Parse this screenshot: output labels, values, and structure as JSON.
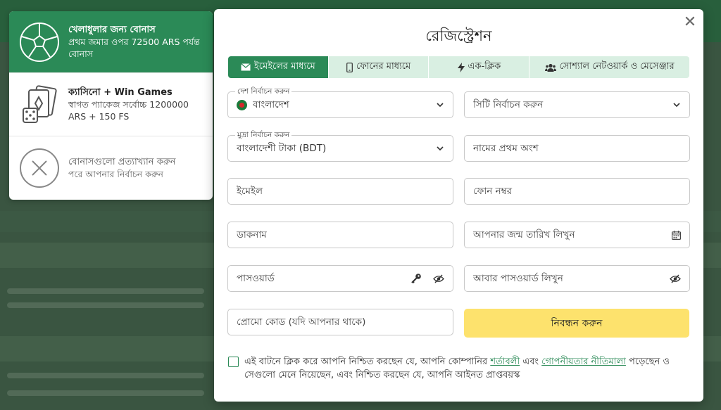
{
  "bonus": {
    "sports": {
      "title": "খেলাধুলার জন্য বোনাস",
      "desc": "প্রথম জমার ওপর 72500 ARS পর্যন্ত বোনাস"
    },
    "casino": {
      "title": "ক্যাসিনো + Win Games",
      "desc": "স্বাগত প্যাকেজ সর্বোচ্চ 1200000 ARS + 150 FS"
    },
    "decline": {
      "title": "বোনাসগুলো প্রত্যাখ্যান করুন",
      "desc": "পরে আপনার নির্বাচন করুন"
    }
  },
  "modal": {
    "title": "রেজিস্ট্রেশন",
    "close": "✕",
    "tabs": [
      {
        "label": "ইমেইলের মাধ্যমে",
        "icon": "envelope-icon"
      },
      {
        "label": "ফোনের মাধ্যমে",
        "icon": "phone-icon"
      },
      {
        "label": "এক-ক্লিক",
        "icon": "lightning-icon"
      },
      {
        "label": "সোশ্যাল নেটওয়ার্ক ও মেসেঞ্জার",
        "icon": "users-icon"
      }
    ],
    "country": {
      "label": "দেশ নির্বাচন করুন",
      "value": "বাংলাদেশ"
    },
    "city": {
      "placeholder": "সিটি নির্বাচন করুন"
    },
    "currency": {
      "label": "মুদ্রা নির্বাচন করুন",
      "value": "বাংলাদেশী টাকা (BDT)"
    },
    "first_name": {
      "placeholder": "নামের প্রথম অংশ"
    },
    "email": {
      "placeholder": "ইমেইল"
    },
    "phone": {
      "placeholder": "ফোন নম্বর"
    },
    "nickname": {
      "placeholder": "ডাকনাম"
    },
    "birthdate": {
      "placeholder": "আপনার জন্ম তারিখ লিখুন"
    },
    "password": {
      "placeholder": "পাসওয়ার্ড"
    },
    "password_repeat": {
      "placeholder": "আবার পাসওয়ার্ড লিখুন"
    },
    "promo": {
      "placeholder": "প্রোমো কোড (যদি আপনার থাকে)"
    },
    "register_button": "নিবন্ধন করুন",
    "terms": {
      "part1": "এই বাটনে ক্লিক করে আপনি নিশ্চিত করছেন যে, আপনি কোম্পানির ",
      "link1": "শর্তাবলী",
      "part2": " এবং ",
      "link2": "গোপনীয়তার নীতিমালা",
      "part3": " পড়েছেন ও সেগুলো মেনে নিয়েছেন, এবং নিশ্চিত করছেন যে, আপনি আইনত প্রাপ্তবয়স্ক"
    }
  },
  "colors": {
    "accent": "#2b8a57",
    "button": "#fde26d",
    "tab_bg": "#d9efe2"
  }
}
